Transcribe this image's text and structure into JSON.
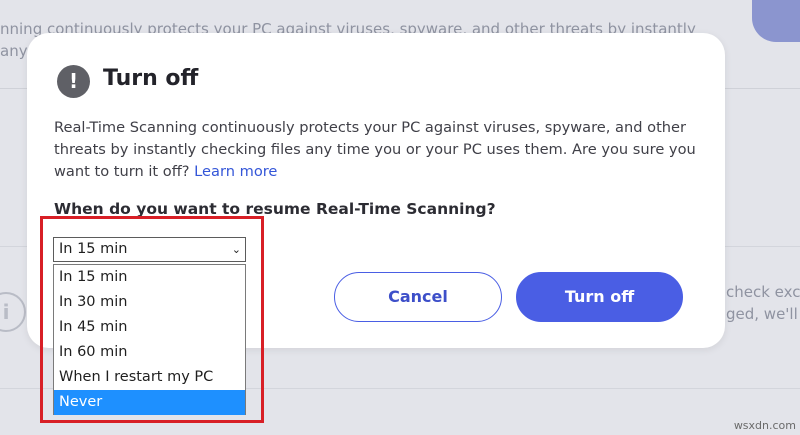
{
  "background": {
    "text_line1": "nning continuously protects your PC against viruses, spyware, and other threats by instantly",
    "text_line2": "any time",
    "right_text1": "check exclu",
    "right_text2": "ged, we'll",
    "info_icon": "info-icon"
  },
  "dialog": {
    "title": "Turn off",
    "title_icon": "exclamation-icon",
    "description": "Real-Time Scanning continuously protects your PC against viruses, spyware, and other threats by instantly checking files any time you or your PC uses them. Are you sure you want to turn it off?",
    "learn_more": "Learn more",
    "question": "When do you want to resume Real-Time Scanning?",
    "select": {
      "selected_value": "In 15 min",
      "options": [
        "In 15 min",
        "In 30 min",
        "In 45 min",
        "In 60 min",
        "When I restart my PC",
        "Never"
      ],
      "highlighted_option": "Never"
    },
    "cancel_label": "Cancel",
    "turn_off_label": "Turn off"
  },
  "watermark": "wsxdn.com",
  "colors": {
    "accent": "#4a5ee4",
    "highlight_box": "#d81f26",
    "selected_option": "#1e90ff",
    "link": "#3456d8"
  }
}
